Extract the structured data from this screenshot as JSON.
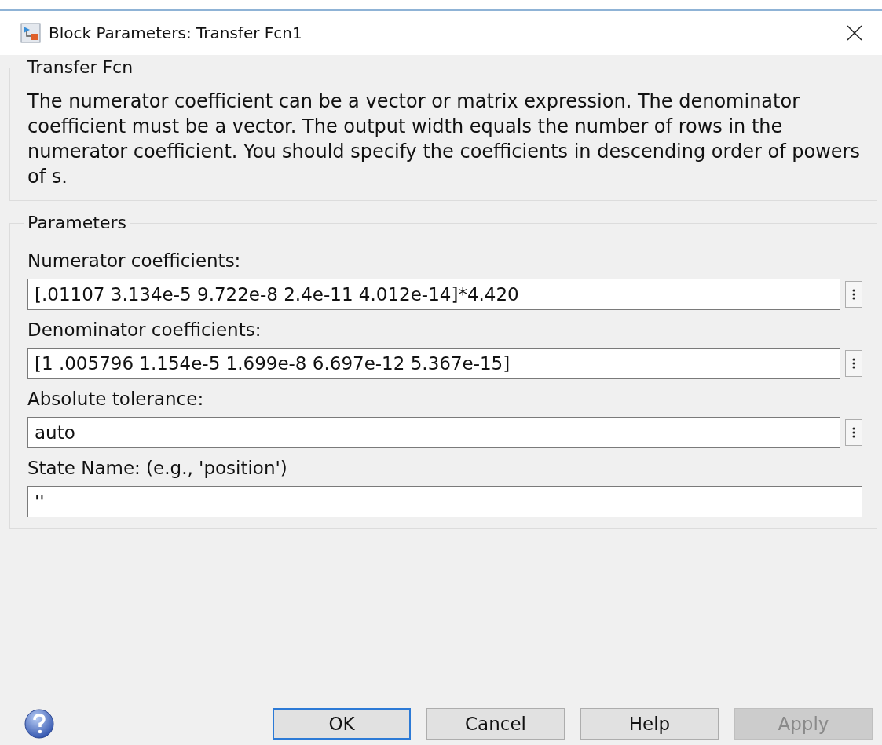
{
  "window": {
    "title": "Block Parameters: Transfer Fcn1"
  },
  "description": {
    "title": "Transfer Fcn",
    "text": "The numerator coefficient can be a vector or matrix expression. The denominator coefficient must be a vector. The output width equals the number of rows in the numerator coefficient. You should specify the coefficients in descending order of powers of s."
  },
  "parameters": {
    "title": "Parameters",
    "fields": [
      {
        "label": "Numerator coefficients:",
        "value": "[.01107 3.134e-5 9.722e-8 2.4e-11 4.012e-14]*4.420",
        "menu": true
      },
      {
        "label": "Denominator coefficients:",
        "value": "[1 .005796 1.154e-5 1.699e-8 6.697e-12 5.367e-15]",
        "menu": true
      },
      {
        "label": "Absolute tolerance:",
        "value": "auto",
        "menu": true
      },
      {
        "label": "State Name: (e.g., 'position')",
        "value": "''",
        "menu": false
      }
    ]
  },
  "buttons": [
    {
      "label": "OK",
      "default": true,
      "disabled": false
    },
    {
      "label": "Cancel",
      "default": false,
      "disabled": false
    },
    {
      "label": "Help",
      "default": false,
      "disabled": false
    },
    {
      "label": "Apply",
      "default": false,
      "disabled": true
    }
  ]
}
